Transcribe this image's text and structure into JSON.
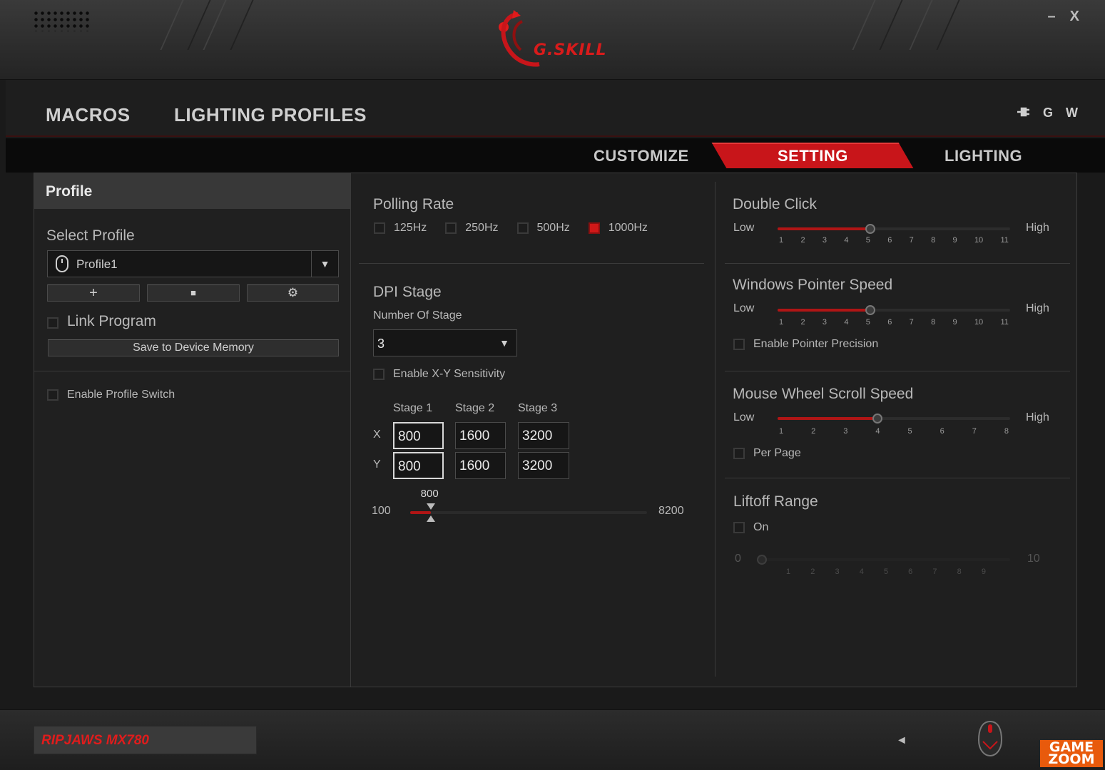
{
  "window": {
    "brand": "G.SKILL",
    "minimize": "–",
    "close": "X"
  },
  "main_nav": {
    "items": [
      "MACROS",
      "LIGHTING PROFILES"
    ],
    "right_icons": [
      "plug-icon",
      "G",
      "W"
    ]
  },
  "tabs": {
    "customize": "CUSTOMIZE",
    "setting": "SETTING",
    "lighting": "LIGHTING",
    "active": "SETTING"
  },
  "profile": {
    "header": "Profile",
    "select_label": "Select Profile",
    "selected": "Profile1",
    "buttons": {
      "add": "+",
      "delete": "■",
      "settings": "⚙"
    },
    "link_program": "Link Program",
    "save_button": "Save to Device Memory",
    "enable_switch": "Enable Profile Switch"
  },
  "polling_rate": {
    "title": "Polling Rate",
    "options": [
      "125Hz",
      "250Hz",
      "500Hz",
      "1000Hz"
    ],
    "selected": "1000Hz"
  },
  "dpi_stage": {
    "title": "DPI Stage",
    "number_label": "Number Of Stage",
    "number_value": "3",
    "xy_sensitivity": "Enable X-Y Sensitivity",
    "headers": [
      "Stage 1",
      "Stage 2",
      "Stage 3"
    ],
    "row_labels": [
      "X",
      "Y"
    ],
    "x_values": [
      "800",
      "1600",
      "3200"
    ],
    "y_values": [
      "800",
      "1600",
      "3200"
    ],
    "slider_min": "100",
    "slider_max": "8200",
    "slider_value": "800",
    "slider_fraction": 0.0864
  },
  "double_click": {
    "title": "Double Click",
    "low": "Low",
    "high": "High",
    "ticks": [
      "1",
      "2",
      "3",
      "4",
      "5",
      "6",
      "7",
      "8",
      "9",
      "10",
      "11"
    ],
    "value": 5
  },
  "pointer_speed": {
    "title": "Windows Pointer Speed",
    "low": "Low",
    "high": "High",
    "ticks": [
      "1",
      "2",
      "3",
      "4",
      "5",
      "6",
      "7",
      "8",
      "9",
      "10",
      "11"
    ],
    "value": 5,
    "precision": "Enable Pointer Precision"
  },
  "scroll_speed": {
    "title": "Mouse Wheel Scroll Speed",
    "low": "Low",
    "high": "High",
    "ticks": [
      "1",
      "2",
      "3",
      "4",
      "5",
      "6",
      "7",
      "8"
    ],
    "value": 4,
    "per_page": "Per Page"
  },
  "liftoff": {
    "title": "Liftoff Range",
    "on": "On",
    "min": "0",
    "max": "10",
    "ticks": [
      "1",
      "2",
      "3",
      "4",
      "5",
      "6",
      "7",
      "8",
      "9"
    ],
    "value": 0
  },
  "footer": {
    "device": "RIPJAWS MX780",
    "prev": "◄",
    "watermark_line1": "GAME",
    "watermark_line2": "ZOOM"
  },
  "colors": {
    "accent": "#c8151a",
    "background": "#1f1f1f",
    "panel_header": "#383838"
  }
}
